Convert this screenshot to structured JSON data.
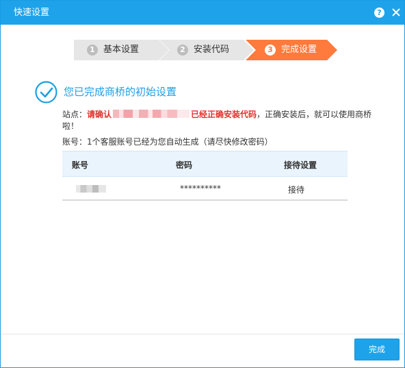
{
  "window": {
    "title": "快速设置",
    "help": "?"
  },
  "colors": {
    "titlebar": "#1ea3ea",
    "active_step": "#ff7a3d",
    "inactive_step": "#e6e6e6",
    "error_text": "#e0322c",
    "headline": "#1c9fe3"
  },
  "steps": [
    {
      "num": "1",
      "label": "基本设置",
      "state": "done"
    },
    {
      "num": "2",
      "label": "安装代码",
      "state": "done"
    },
    {
      "num": "3",
      "label": "完成设置",
      "state": "active"
    }
  ],
  "main": {
    "headline": "您已完成商桥的初始设置",
    "site_prefix": "站点：",
    "site_warning_start": "请确认",
    "site_warning_end": "已经正确安装代码",
    "site_after": "，正确安装后，就可以使用商桥啦！",
    "account_note": "账号：1个客服账号已经为您自动生成（请尽快修改密码）"
  },
  "table": {
    "headers": [
      "账号",
      "密码",
      "接待设置"
    ],
    "rows": [
      {
        "password": "**********",
        "reception": "接待"
      }
    ]
  },
  "footer": {
    "finish_label": "完成"
  }
}
